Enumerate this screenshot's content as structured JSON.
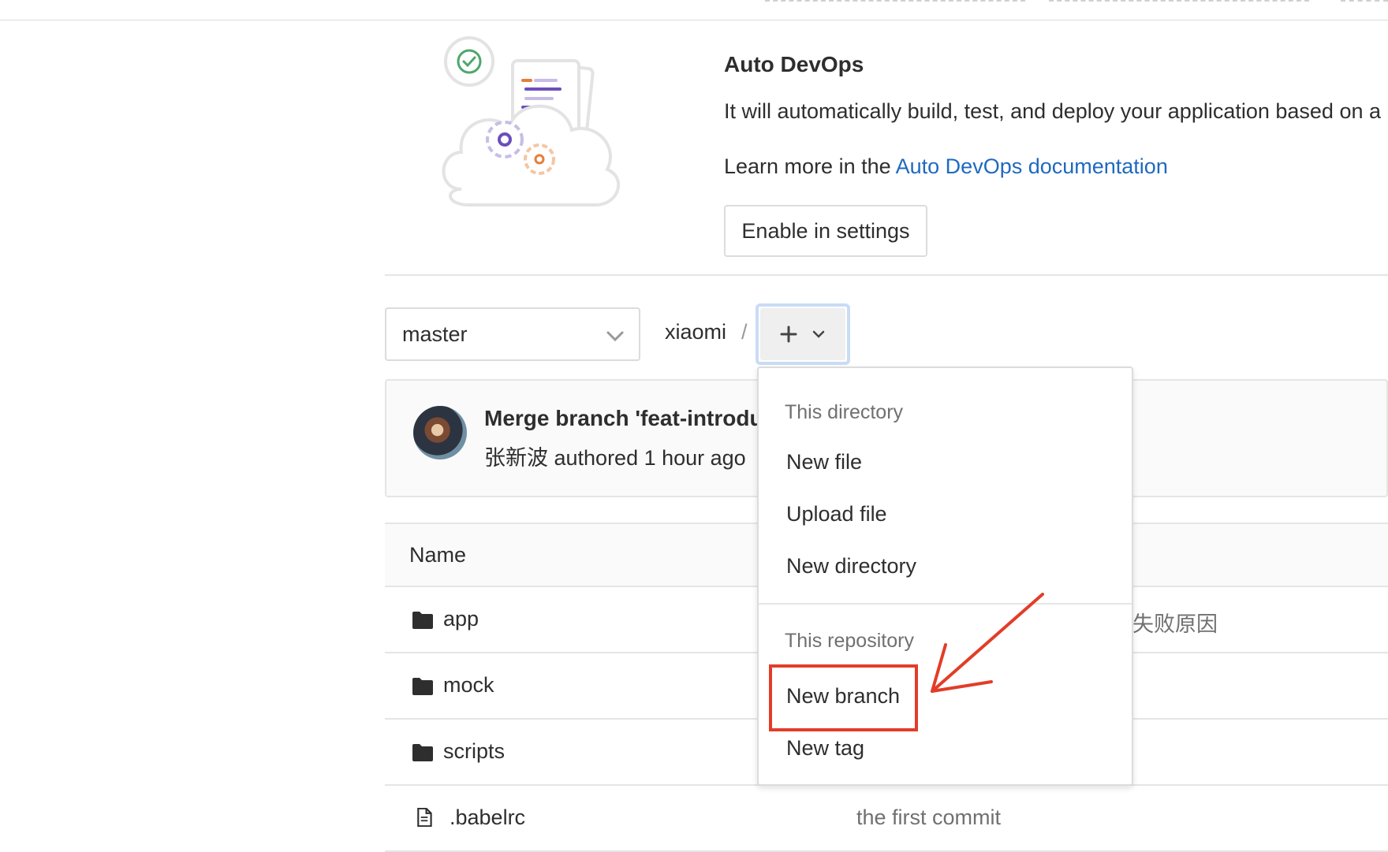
{
  "devops": {
    "title": "Auto DevOps",
    "description": "It will automatically build, test, and deploy your application based on a",
    "learn_prefix": "Learn more in the ",
    "learn_link": "Auto DevOps documentation",
    "enable_button": "Enable in settings"
  },
  "toolbar": {
    "branch": "master",
    "project": "xiaomi",
    "separator": "/"
  },
  "commit": {
    "title": "Merge branch 'feat-introdu",
    "author": "张新波",
    "meta_rest": " authored 1 hour ago"
  },
  "files": {
    "column_name": "Name",
    "rows": [
      {
        "name": "app",
        "type": "folder",
        "message": "失败原因"
      },
      {
        "name": "mock",
        "type": "folder",
        "message": ""
      },
      {
        "name": "scripts",
        "type": "folder",
        "message": ""
      },
      {
        "name": ".babelrc",
        "type": "file",
        "message": "the first commit"
      }
    ]
  },
  "dropdown": {
    "directory_header": "This directory",
    "new_file": "New file",
    "upload_file": "Upload file",
    "new_directory": "New directory",
    "repository_header": "This repository",
    "new_branch": "New branch",
    "new_tag": "New tag"
  },
  "colors": {
    "link": "#1f69c0",
    "annotation": "#e23d28",
    "focus_ring": "#c9dcf6"
  },
  "icons": [
    "check-circle-icon",
    "chevron-down-icon",
    "plus-icon",
    "folder-icon",
    "file-icon",
    "gear-icon"
  ]
}
